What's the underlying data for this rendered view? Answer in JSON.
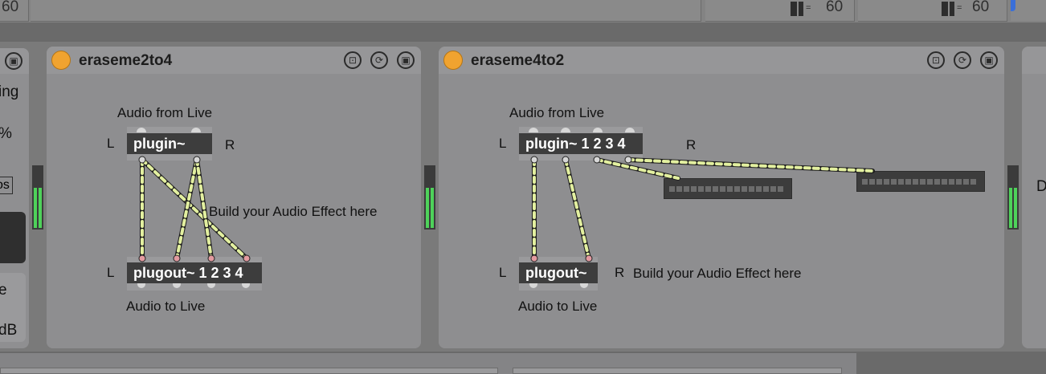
{
  "top_bar": {
    "left_value": "60",
    "mid_value": "60",
    "right_value": "60"
  },
  "left_panel": {
    "fragments": [
      "ing",
      "%",
      "os",
      "e",
      "dB"
    ]
  },
  "right_panel": {
    "fragment": "D"
  },
  "devices": [
    {
      "title": "eraseme2to4",
      "audio_from_label": "Audio from Live",
      "audio_to_label": "Audio to Live",
      "left_in": "L",
      "right_in": "R",
      "left_out": "L",
      "plugin_label": "plugin~",
      "plugout_label": "plugout~ 1 2 3 4",
      "comment": "Build your Audio Effect here"
    },
    {
      "title": "eraseme4to2",
      "audio_from_label": "Audio from Live",
      "audio_to_label": "Audio to Live",
      "left_in": "L",
      "right_in": "R",
      "left_out": "L",
      "right_out": "R",
      "plugin_label": "plugin~ 1 2 3 4",
      "plugout_label": "plugout~",
      "comment": "Build your Audio Effect here"
    }
  ],
  "colors": {
    "power": "#f0a330",
    "patch_cord": "#e3f0a0",
    "meter": "#4ed25a"
  }
}
